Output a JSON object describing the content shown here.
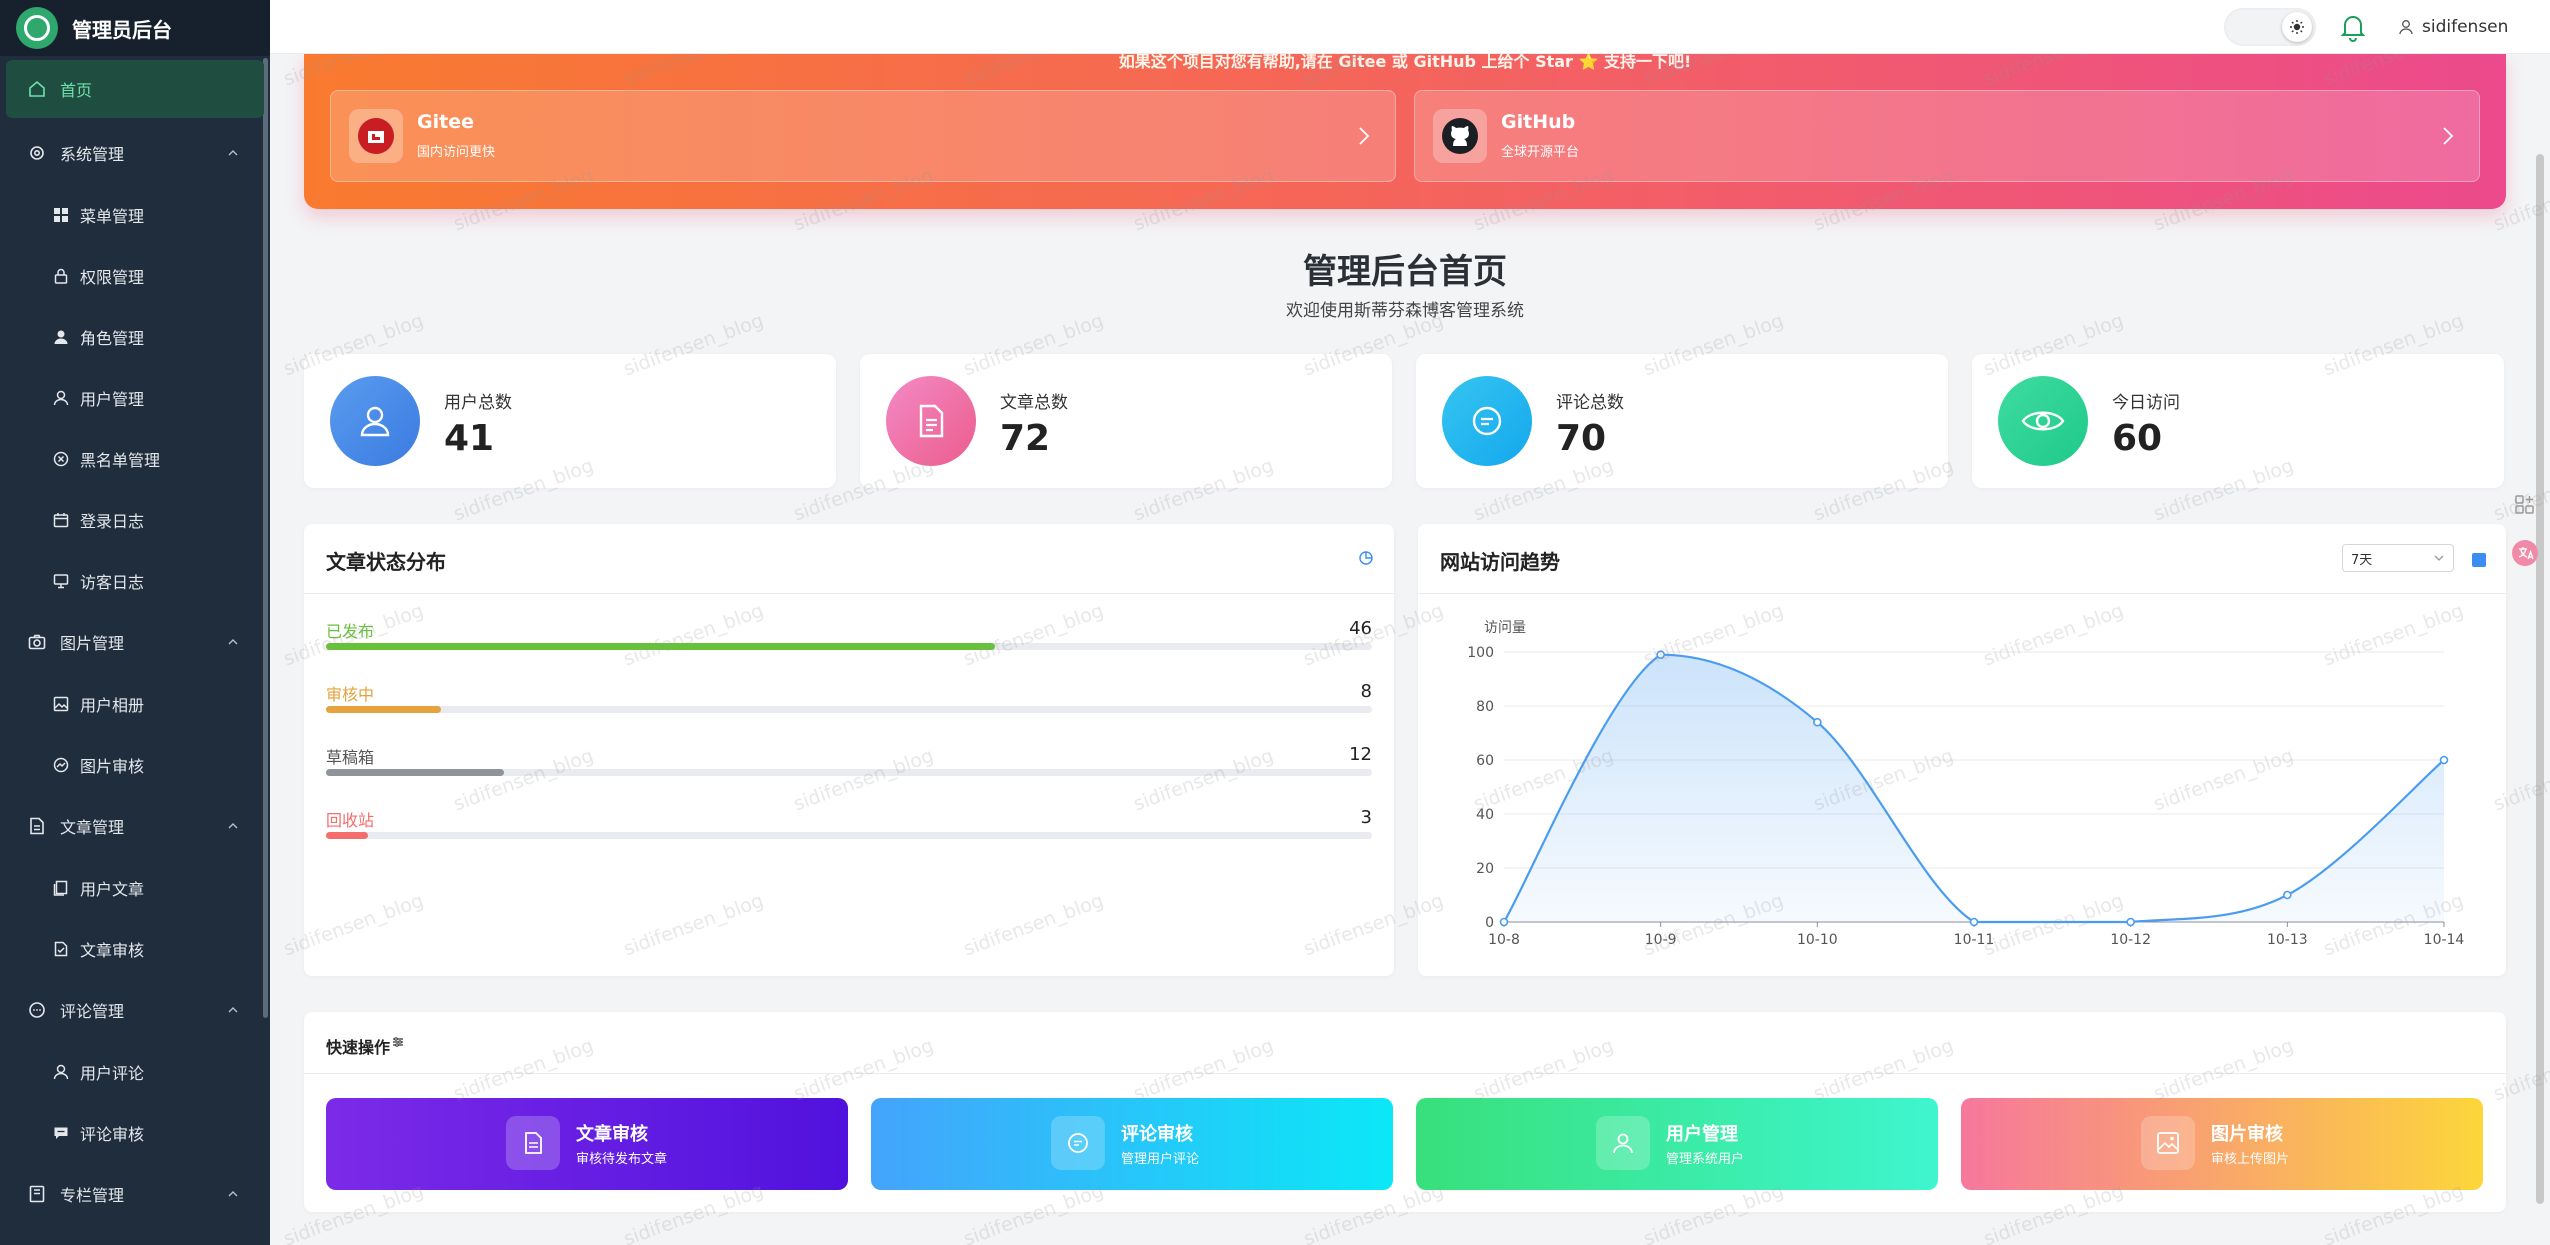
{
  "brand": {
    "title": "管理员后台"
  },
  "sidebar": {
    "items": [
      {
        "label": "首页"
      },
      {
        "label": "系统管理"
      },
      {
        "label": "菜单管理"
      },
      {
        "label": "权限管理"
      },
      {
        "label": "角色管理"
      },
      {
        "label": "用户管理"
      },
      {
        "label": "黑名单管理"
      },
      {
        "label": "登录日志"
      },
      {
        "label": "访客日志"
      },
      {
        "label": "图片管理"
      },
      {
        "label": "用户相册"
      },
      {
        "label": "图片审核"
      },
      {
        "label": "文章管理"
      },
      {
        "label": "用户文章"
      },
      {
        "label": "文章审核"
      },
      {
        "label": "评论管理"
      },
      {
        "label": "用户评论"
      },
      {
        "label": "评论审核"
      },
      {
        "label": "专栏管理"
      }
    ]
  },
  "topbar": {
    "username": "sidifensen"
  },
  "banner": {
    "note": "如果这个项目对您有帮助,请在 Gitee 或 GitHub 上给个 Star ⭐ 支持一下吧!",
    "repos": [
      {
        "name": "Gitee",
        "desc": "国内访问更快"
      },
      {
        "name": "GitHub",
        "desc": "全球开源平台"
      }
    ]
  },
  "page": {
    "title": "管理后台首页",
    "subtitle": "欢迎使用斯蒂芬森博客管理系统"
  },
  "stats": [
    {
      "label": "用户总数",
      "value": "41"
    },
    {
      "label": "文章总数",
      "value": "72"
    },
    {
      "label": "评论总数",
      "value": "70"
    },
    {
      "label": "今日访问",
      "value": "60"
    }
  ],
  "article_status": {
    "title": "文章状态分布",
    "rows": [
      {
        "label": "已发布",
        "count": "46",
        "fraction": 0.64,
        "color": "#67c23a"
      },
      {
        "label": "审核中",
        "count": "8",
        "fraction": 0.11,
        "color": "#e6a23c"
      },
      {
        "label": "草稿箱",
        "count": "12",
        "fraction": 0.17,
        "color": "#909399"
      },
      {
        "label": "回收站",
        "count": "3",
        "fraction": 0.04,
        "color": "#f56c6c"
      }
    ]
  },
  "visit_trend": {
    "title": "网站访问趋势",
    "range_select": "7天"
  },
  "chart_data": {
    "type": "area",
    "title": "",
    "xlabel": "",
    "ylabel": "访问量",
    "x": [
      "10-8",
      "10-9",
      "10-10",
      "10-11",
      "10-12",
      "10-13",
      "10-14"
    ],
    "series": [
      {
        "values": [
          0,
          99,
          74,
          0,
          0,
          10,
          60
        ]
      }
    ],
    "ylim": [
      0,
      100
    ],
    "yticks": [
      0,
      20,
      40,
      60,
      80,
      100
    ],
    "grid": true,
    "color": "#4a9cf0"
  },
  "quick": {
    "title": "快速操作",
    "actions": [
      {
        "title": "文章审核",
        "desc": "审核待发布文章"
      },
      {
        "title": "评论审核",
        "desc": "管理用户评论"
      },
      {
        "title": "用户管理",
        "desc": "管理系统用户"
      },
      {
        "title": "图片审核",
        "desc": "审核上传图片"
      }
    ]
  },
  "watermark": "sidifensen_blog"
}
